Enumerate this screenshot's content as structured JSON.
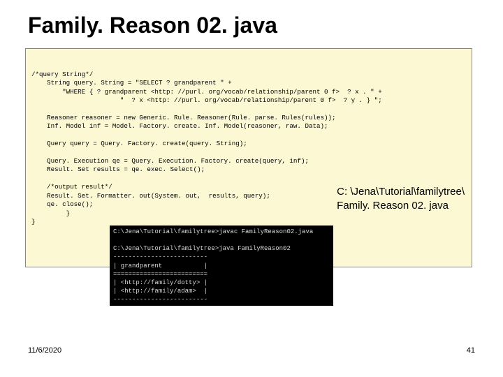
{
  "title": "Family. Reason 02. java",
  "code": "/*query String*/\n    String query. String = \"SELECT ? grandparent \" +\n        \"WHERE { ? grandparent <http: //purl. org/vocab/relationship/parent 0 f>  ? x . \" +\n                       \"  ? x <http: //purl. org/vocab/relationship/parent 0 f>  ? y . } \";\n\n    Reasoner reasoner = new Generic. Rule. Reasoner(Rule. parse. Rules(rules));\n    Inf. Model inf = Model. Factory. create. Inf. Model(reasoner, raw. Data);\n\n    Query query = Query. Factory. create(query. String);\n\n    Query. Execution qe = Query. Execution. Factory. create(query, inf);\n    Result. Set results = qe. exec. Select();\n\n    /*output result*/\n    Result. Set. Formatter. out(System. out,  results, query);\n    qe. close();\n         }\n}",
  "path_label": "C: \\Jena\\Tutorial\\familytree\\\nFamily. Reason 02. java",
  "terminal": "C:\\Jena\\Tutorial\\familytree>javac FamilyReason02.java\n\nC:\\Jena\\Tutorial\\familytree>java FamilyReason02\n-------------------------\n| grandparent           |\n=========================\n| <http://family/dotty> |\n| <http://family/adam>  |\n-------------------------",
  "footer": {
    "date": "11/6/2020",
    "page": "41"
  }
}
